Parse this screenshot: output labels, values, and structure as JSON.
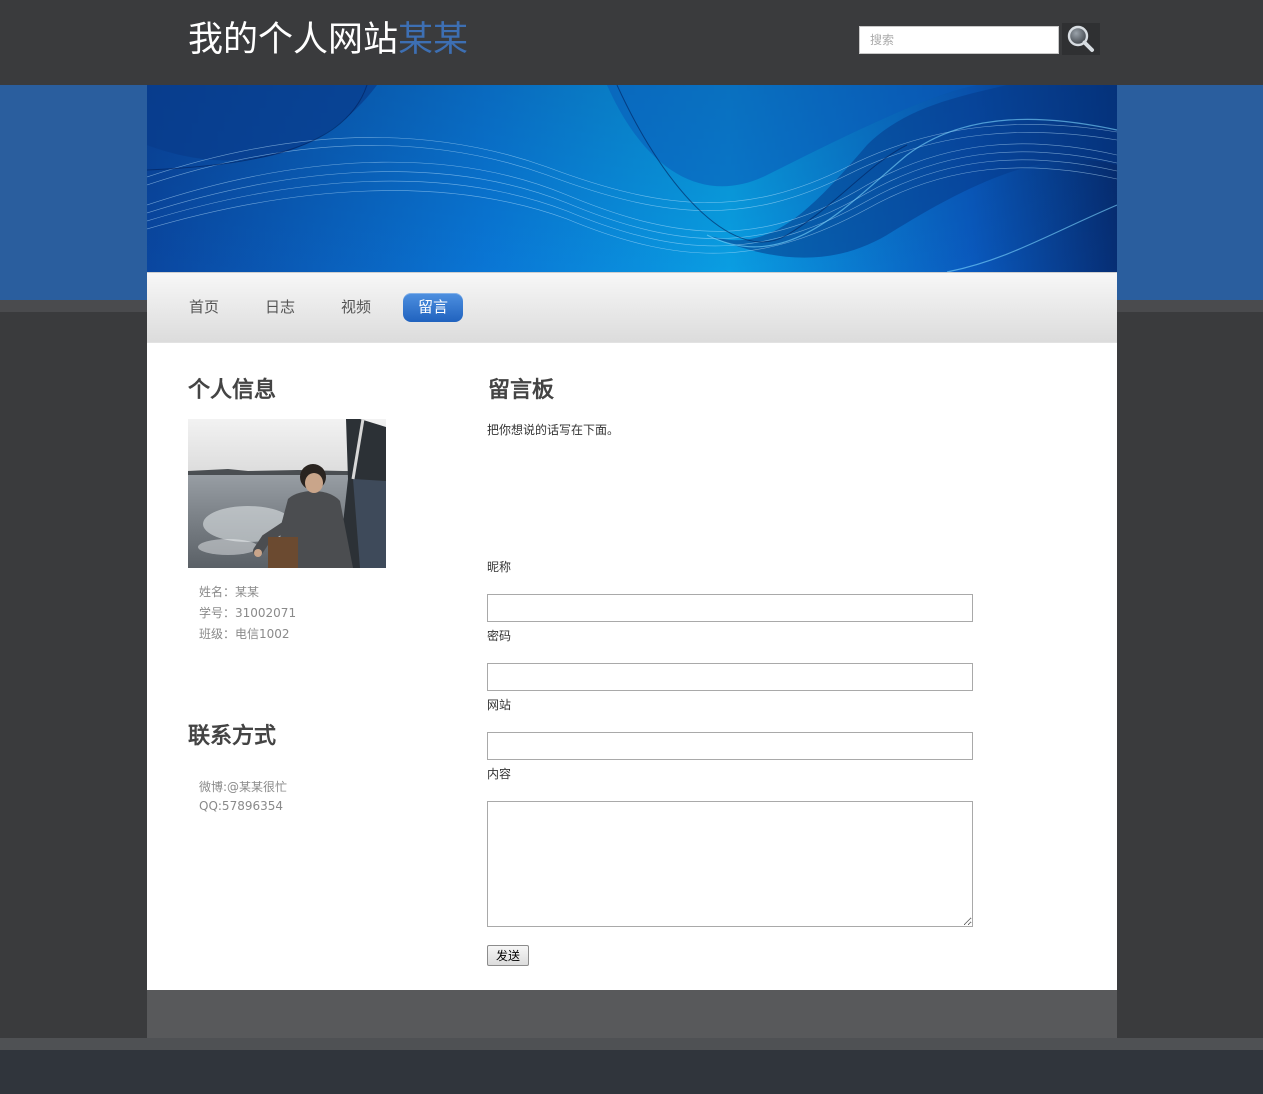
{
  "header": {
    "title_main": "我的个人网站",
    "title_accent": "某某",
    "search_placeholder": "搜索",
    "search_icon": "magnifier-icon"
  },
  "nav": {
    "items": [
      {
        "label": "首页",
        "active": false
      },
      {
        "label": "日志",
        "active": false
      },
      {
        "label": "视频",
        "active": false
      },
      {
        "label": "留言",
        "active": true
      }
    ]
  },
  "sidebar": {
    "profile": {
      "title": "个人信息",
      "lines": [
        "姓名：某某",
        "学号：31002071",
        "班级：电信1002"
      ]
    },
    "contact": {
      "title": "联系方式",
      "lines": [
        "微博:@某某很忙",
        "QQ:57896354"
      ]
    }
  },
  "main": {
    "title": "留言板",
    "intro": "把你想说的话写在下面。",
    "form": {
      "nickname_label": "昵称",
      "password_label": "密码",
      "website_label": "网站",
      "content_label": "内容",
      "nickname_value": "",
      "password_value": "",
      "website_value": "",
      "content_value": "",
      "submit_label": "发送"
    }
  },
  "colors": {
    "header_bg": "#3a3b3d",
    "title_accent": "#3d6fb3",
    "blue_band": "#2a5e9e",
    "nav_active": "#2c6cc6",
    "footer": "#58595b"
  }
}
